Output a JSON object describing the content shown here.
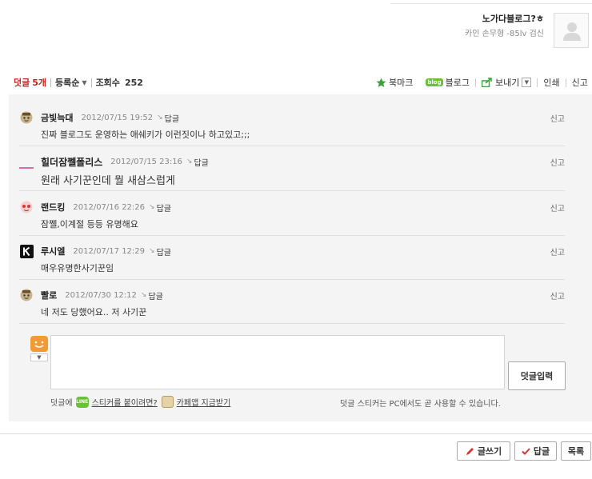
{
  "author": {
    "name": "노가다블로그?ㅎ",
    "meta": "카인 손무형  -85lv 검신"
  },
  "meta_bar": {
    "comment_label": "덧글",
    "comment_count": "5개",
    "sort_label": "등록순",
    "views_label": "조회수",
    "views_count": "252"
  },
  "actions": {
    "bookmark": "북마크",
    "blog_badge": "blog",
    "blog": "블로그",
    "send": "보내기",
    "print": "인쇄",
    "report": "신고"
  },
  "comments": [
    {
      "nick": "금빛늑대",
      "date": "2012/07/15 19:52",
      "reply": "답글",
      "report": "신고",
      "text": "진짜 블로그도 운영하는 애쉐키가 이런짓이나 하고있고;;;"
    },
    {
      "nick": "힐더잠쩰폴리스",
      "date": "2012/07/15 23:16",
      "reply": "답글",
      "report": "신고",
      "text": "원래 사기꾼인데 뭘 새삼스럽게"
    },
    {
      "nick": "랜드킹",
      "date": "2012/07/16 22:26",
      "reply": "답글",
      "report": "신고",
      "text": "잠쩰,이계절 등등 유명해요"
    },
    {
      "nick": "루시엘",
      "date": "2012/07/17 12:29",
      "reply": "답글",
      "report": "신고",
      "text": "매우유명한사기꾼임"
    },
    {
      "nick": "빨로",
      "date": "2012/07/30 12:12",
      "reply": "답글",
      "report": "신고",
      "text": "네 저도 당했어요.. 저 사기꾼"
    }
  ],
  "write": {
    "input_value": "",
    "submit": "덧글입력",
    "hint_prefix": "덧글에",
    "hint_line_badge": "LINE",
    "hint_link": "스티커를 붙이려면?",
    "hint_cafe": "카페앱 지금받기",
    "note": "덧글 스티커는 PC에서도 곧 사용할 수 있습니다."
  },
  "bottom": {
    "write": "글쓰기",
    "reply": "답글",
    "list": "목록"
  },
  "colors": {
    "accent": "#c2231d",
    "panel_bg": "#f4f4f4",
    "blog_green": "#6bbf3b",
    "sticker_orange": "#f39a34"
  }
}
